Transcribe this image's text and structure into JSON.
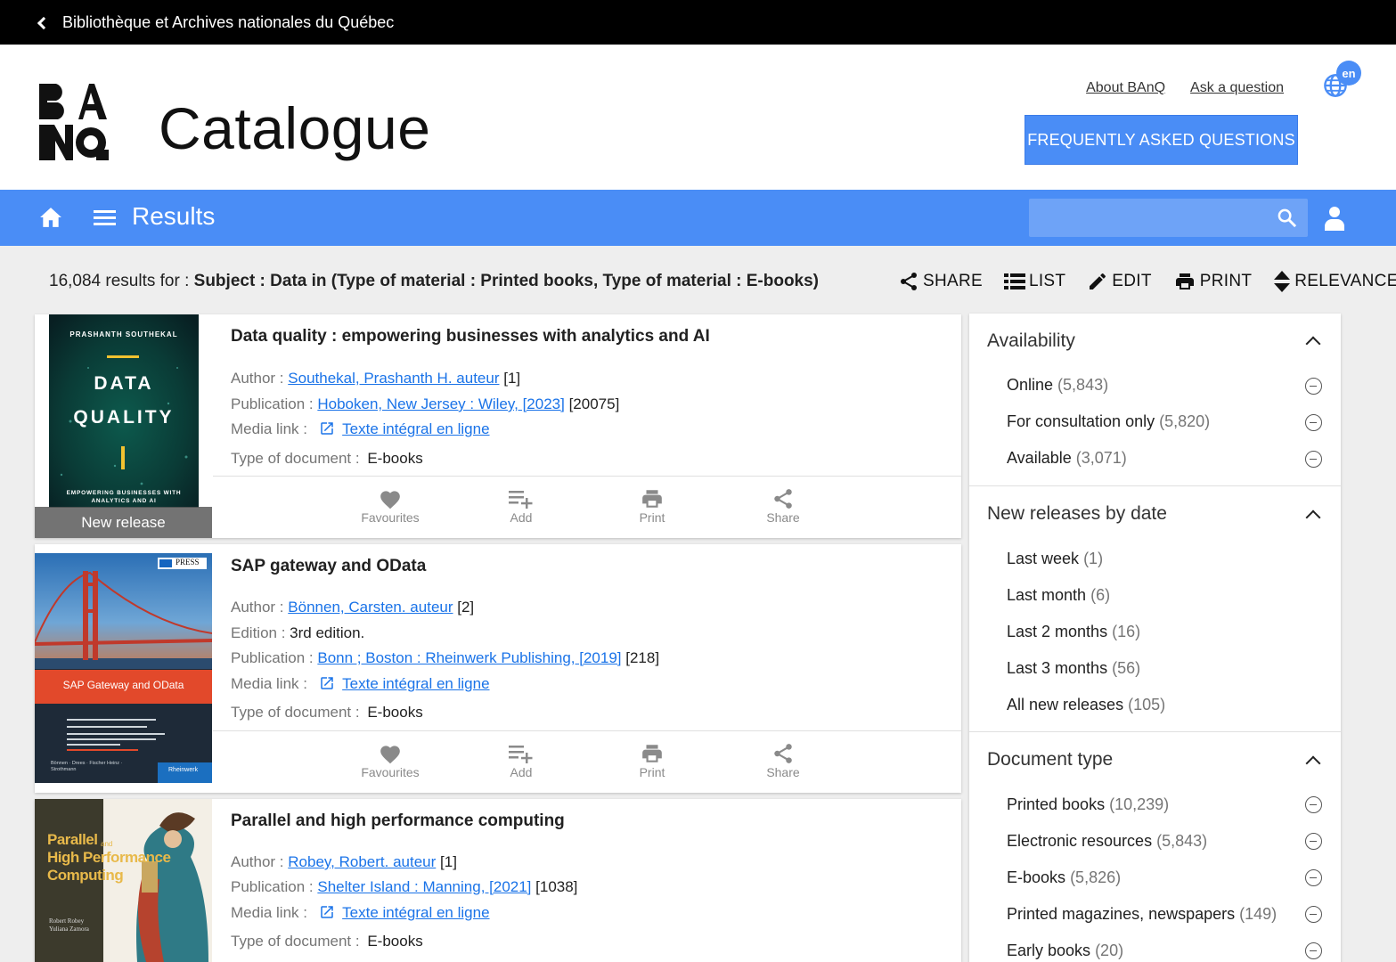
{
  "topbar": {
    "label": "Bibliothèque et Archives nationales du Québec"
  },
  "header": {
    "logo_alt": "BAnQ",
    "title": "Catalogue",
    "links": [
      "About BAnQ",
      "Ask a question"
    ],
    "faq_label": "FREQUENTLY ASKED QUESTIONS",
    "lang_badge": "en"
  },
  "nav": {
    "title": "Results",
    "search_value": ""
  },
  "results_bar": {
    "count_text": "16,084 results for :",
    "query": "Subject : Data in (Type of material : Printed books, Type of material : E-books)",
    "tools": [
      "SHARE",
      "LIST",
      "EDIT",
      "PRINT",
      "RELEVANCE"
    ]
  },
  "labels": {
    "author": "Author :",
    "edition": "Edition :",
    "publication": "Publication :",
    "media": "Media link :",
    "doctype": "Type of document :",
    "new_release": "New release"
  },
  "actions": [
    "Favourites",
    "Add",
    "Print",
    "Share"
  ],
  "results": [
    {
      "title": "Data quality : empowering businesses with analytics and AI",
      "author": "Southekal, Prashanth H. auteur",
      "author_n": "[1]",
      "publication": "Hoboken, New Jersey : Wiley, [2023]",
      "publication_n": "[20075]",
      "media": "Texte intégral en ligne",
      "doctype": "E-books",
      "cover": {
        "author": "PRASHANTH SOUTHEKAL",
        "line1": "DATA",
        "line2": "QUALITY",
        "subtitle": "EMPOWERING BUSINESSES WITH ANALYTICS AND AI"
      }
    },
    {
      "title": "SAP gateway and OData",
      "author": "Bönnen, Carsten. auteur",
      "author_n": "[2]",
      "edition": "3rd edition.",
      "publication": "Bonn ; Boston : Rheinwerk Publishing, [2019]",
      "publication_n": "[218]",
      "media": "Texte intégral en ligne",
      "doctype": "E-books",
      "cover": {
        "badge": "PRESS",
        "title": "SAP Gateway and OData",
        "authors": "Bönnen · Drees · Fischer Heinz · Strothmann",
        "publisher": "Rheinwerk"
      }
    },
    {
      "title": "Parallel and high performance computing",
      "author": "Robey, Robert. auteur",
      "author_n": "[1]",
      "publication": "Shelter Island : Manning, [2021]",
      "publication_n": "[1038]",
      "media": "Texte intégral en ligne",
      "doctype": "E-books",
      "cover": {
        "line1": "Parallel",
        "and": "and",
        "line2": "High Performance",
        "line3": "Computing",
        "authors1": "Robert Robey",
        "authors2": "Yuliana Zamora"
      }
    }
  ],
  "facets": [
    {
      "title": "Availability",
      "items": [
        {
          "label": "Online",
          "count": "(5,843)"
        },
        {
          "label": "For consultation only",
          "count": "(5,820)"
        },
        {
          "label": "Available",
          "count": "(3,071)"
        }
      ]
    },
    {
      "title": "New releases by date",
      "items": [
        {
          "label": "Last week",
          "count": "(1)"
        },
        {
          "label": "Last month",
          "count": "(6)"
        },
        {
          "label": "Last 2 months",
          "count": "(16)"
        },
        {
          "label": "Last 3 months",
          "count": "(56)"
        },
        {
          "label": "All new releases",
          "count": "(105)"
        }
      ]
    },
    {
      "title": "Document type",
      "items": [
        {
          "label": "Printed books",
          "count": "(10,239)"
        },
        {
          "label": "Electronic resources",
          "count": "(5,843)"
        },
        {
          "label": "E-books",
          "count": "(5,826)"
        },
        {
          "label": "Printed magazines, newspapers",
          "count": "(149)"
        },
        {
          "label": "Early books",
          "count": "(20)"
        }
      ]
    }
  ],
  "colors": {
    "accent": "#4a8df6",
    "link": "#1a73e8"
  }
}
